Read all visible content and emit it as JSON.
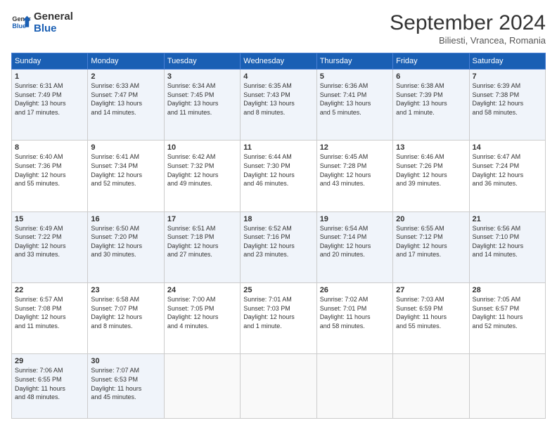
{
  "header": {
    "logo_line1": "General",
    "logo_line2": "Blue",
    "month": "September 2024",
    "location": "Biliesti, Vrancea, Romania"
  },
  "weekdays": [
    "Sunday",
    "Monday",
    "Tuesday",
    "Wednesday",
    "Thursday",
    "Friday",
    "Saturday"
  ],
  "weeks": [
    [
      {
        "day": "1",
        "lines": [
          "Sunrise: 6:31 AM",
          "Sunset: 7:49 PM",
          "Daylight: 13 hours",
          "and 17 minutes."
        ]
      },
      {
        "day": "2",
        "lines": [
          "Sunrise: 6:33 AM",
          "Sunset: 7:47 PM",
          "Daylight: 13 hours",
          "and 14 minutes."
        ]
      },
      {
        "day": "3",
        "lines": [
          "Sunrise: 6:34 AM",
          "Sunset: 7:45 PM",
          "Daylight: 13 hours",
          "and 11 minutes."
        ]
      },
      {
        "day": "4",
        "lines": [
          "Sunrise: 6:35 AM",
          "Sunset: 7:43 PM",
          "Daylight: 13 hours",
          "and 8 minutes."
        ]
      },
      {
        "day": "5",
        "lines": [
          "Sunrise: 6:36 AM",
          "Sunset: 7:41 PM",
          "Daylight: 13 hours",
          "and 5 minutes."
        ]
      },
      {
        "day": "6",
        "lines": [
          "Sunrise: 6:38 AM",
          "Sunset: 7:39 PM",
          "Daylight: 13 hours",
          "and 1 minute."
        ]
      },
      {
        "day": "7",
        "lines": [
          "Sunrise: 6:39 AM",
          "Sunset: 7:38 PM",
          "Daylight: 12 hours",
          "and 58 minutes."
        ]
      }
    ],
    [
      {
        "day": "8",
        "lines": [
          "Sunrise: 6:40 AM",
          "Sunset: 7:36 PM",
          "Daylight: 12 hours",
          "and 55 minutes."
        ]
      },
      {
        "day": "9",
        "lines": [
          "Sunrise: 6:41 AM",
          "Sunset: 7:34 PM",
          "Daylight: 12 hours",
          "and 52 minutes."
        ]
      },
      {
        "day": "10",
        "lines": [
          "Sunrise: 6:42 AM",
          "Sunset: 7:32 PM",
          "Daylight: 12 hours",
          "and 49 minutes."
        ]
      },
      {
        "day": "11",
        "lines": [
          "Sunrise: 6:44 AM",
          "Sunset: 7:30 PM",
          "Daylight: 12 hours",
          "and 46 minutes."
        ]
      },
      {
        "day": "12",
        "lines": [
          "Sunrise: 6:45 AM",
          "Sunset: 7:28 PM",
          "Daylight: 12 hours",
          "and 43 minutes."
        ]
      },
      {
        "day": "13",
        "lines": [
          "Sunrise: 6:46 AM",
          "Sunset: 7:26 PM",
          "Daylight: 12 hours",
          "and 39 minutes."
        ]
      },
      {
        "day": "14",
        "lines": [
          "Sunrise: 6:47 AM",
          "Sunset: 7:24 PM",
          "Daylight: 12 hours",
          "and 36 minutes."
        ]
      }
    ],
    [
      {
        "day": "15",
        "lines": [
          "Sunrise: 6:49 AM",
          "Sunset: 7:22 PM",
          "Daylight: 12 hours",
          "and 33 minutes."
        ]
      },
      {
        "day": "16",
        "lines": [
          "Sunrise: 6:50 AM",
          "Sunset: 7:20 PM",
          "Daylight: 12 hours",
          "and 30 minutes."
        ]
      },
      {
        "day": "17",
        "lines": [
          "Sunrise: 6:51 AM",
          "Sunset: 7:18 PM",
          "Daylight: 12 hours",
          "and 27 minutes."
        ]
      },
      {
        "day": "18",
        "lines": [
          "Sunrise: 6:52 AM",
          "Sunset: 7:16 PM",
          "Daylight: 12 hours",
          "and 23 minutes."
        ]
      },
      {
        "day": "19",
        "lines": [
          "Sunrise: 6:54 AM",
          "Sunset: 7:14 PM",
          "Daylight: 12 hours",
          "and 20 minutes."
        ]
      },
      {
        "day": "20",
        "lines": [
          "Sunrise: 6:55 AM",
          "Sunset: 7:12 PM",
          "Daylight: 12 hours",
          "and 17 minutes."
        ]
      },
      {
        "day": "21",
        "lines": [
          "Sunrise: 6:56 AM",
          "Sunset: 7:10 PM",
          "Daylight: 12 hours",
          "and 14 minutes."
        ]
      }
    ],
    [
      {
        "day": "22",
        "lines": [
          "Sunrise: 6:57 AM",
          "Sunset: 7:08 PM",
          "Daylight: 12 hours",
          "and 11 minutes."
        ]
      },
      {
        "day": "23",
        "lines": [
          "Sunrise: 6:58 AM",
          "Sunset: 7:07 PM",
          "Daylight: 12 hours",
          "and 8 minutes."
        ]
      },
      {
        "day": "24",
        "lines": [
          "Sunrise: 7:00 AM",
          "Sunset: 7:05 PM",
          "Daylight: 12 hours",
          "and 4 minutes."
        ]
      },
      {
        "day": "25",
        "lines": [
          "Sunrise: 7:01 AM",
          "Sunset: 7:03 PM",
          "Daylight: 12 hours",
          "and 1 minute."
        ]
      },
      {
        "day": "26",
        "lines": [
          "Sunrise: 7:02 AM",
          "Sunset: 7:01 PM",
          "Daylight: 11 hours",
          "and 58 minutes."
        ]
      },
      {
        "day": "27",
        "lines": [
          "Sunrise: 7:03 AM",
          "Sunset: 6:59 PM",
          "Daylight: 11 hours",
          "and 55 minutes."
        ]
      },
      {
        "day": "28",
        "lines": [
          "Sunrise: 7:05 AM",
          "Sunset: 6:57 PM",
          "Daylight: 11 hours",
          "and 52 minutes."
        ]
      }
    ],
    [
      {
        "day": "29",
        "lines": [
          "Sunrise: 7:06 AM",
          "Sunset: 6:55 PM",
          "Daylight: 11 hours",
          "and 48 minutes."
        ]
      },
      {
        "day": "30",
        "lines": [
          "Sunrise: 7:07 AM",
          "Sunset: 6:53 PM",
          "Daylight: 11 hours",
          "and 45 minutes."
        ]
      },
      {
        "day": "",
        "lines": []
      },
      {
        "day": "",
        "lines": []
      },
      {
        "day": "",
        "lines": []
      },
      {
        "day": "",
        "lines": []
      },
      {
        "day": "",
        "lines": []
      }
    ]
  ]
}
